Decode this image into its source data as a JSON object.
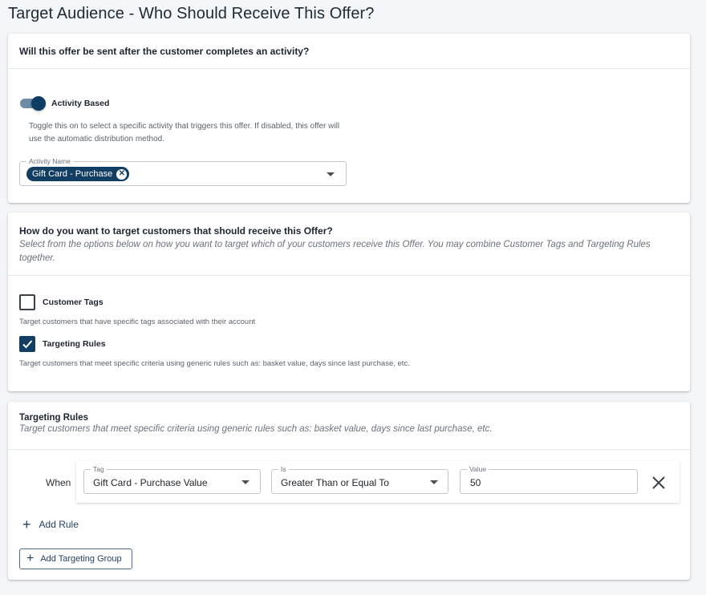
{
  "page": {
    "title": "Target Audience - Who Should Receive This Offer?"
  },
  "activity_card": {
    "question": "Will this offer be sent after the customer completes an activity?",
    "toggle_label": "Activity Based",
    "toggle_on": true,
    "help_text": "Toggle this on to select a specific activity that triggers this offer. If disabled, this offer will use the automatic distribution method.",
    "activity_field_label": "Activity Name",
    "selected_activity": "Gift Card - Purchase"
  },
  "targeting_card": {
    "question": "How do you want to target customers that should receive this Offer?",
    "description": "Select from the options below on how you want to target which of your customers receive this Offer. You may combine Customer Tags and Targeting Rules together.",
    "options": [
      {
        "label": "Customer Tags",
        "checked": false,
        "help": "Target customers that have specific tags associated with their account"
      },
      {
        "label": "Targeting Rules",
        "checked": true,
        "help": "Target customers that meet specific criteria using generic rules such as: basket value, days since last purchase, etc."
      }
    ]
  },
  "rules_card": {
    "title": "Targeting Rules",
    "description": "Target customers that meet specific criteria using generic rules such as: basket value, days since last purchase, etc.",
    "rule": {
      "when_label": "When",
      "tag_label": "Tag",
      "tag_value": "Gift Card - Purchase Value",
      "is_label": "Is",
      "is_value": "Greater Than or Equal To",
      "value_label": "Value",
      "value": "50"
    },
    "add_rule_label": "Add Rule",
    "add_group_label": "Add Targeting Group"
  },
  "colors": {
    "primary": "#123e63",
    "toggle_track": "#6d8ba6",
    "background": "#f3f5f8"
  }
}
